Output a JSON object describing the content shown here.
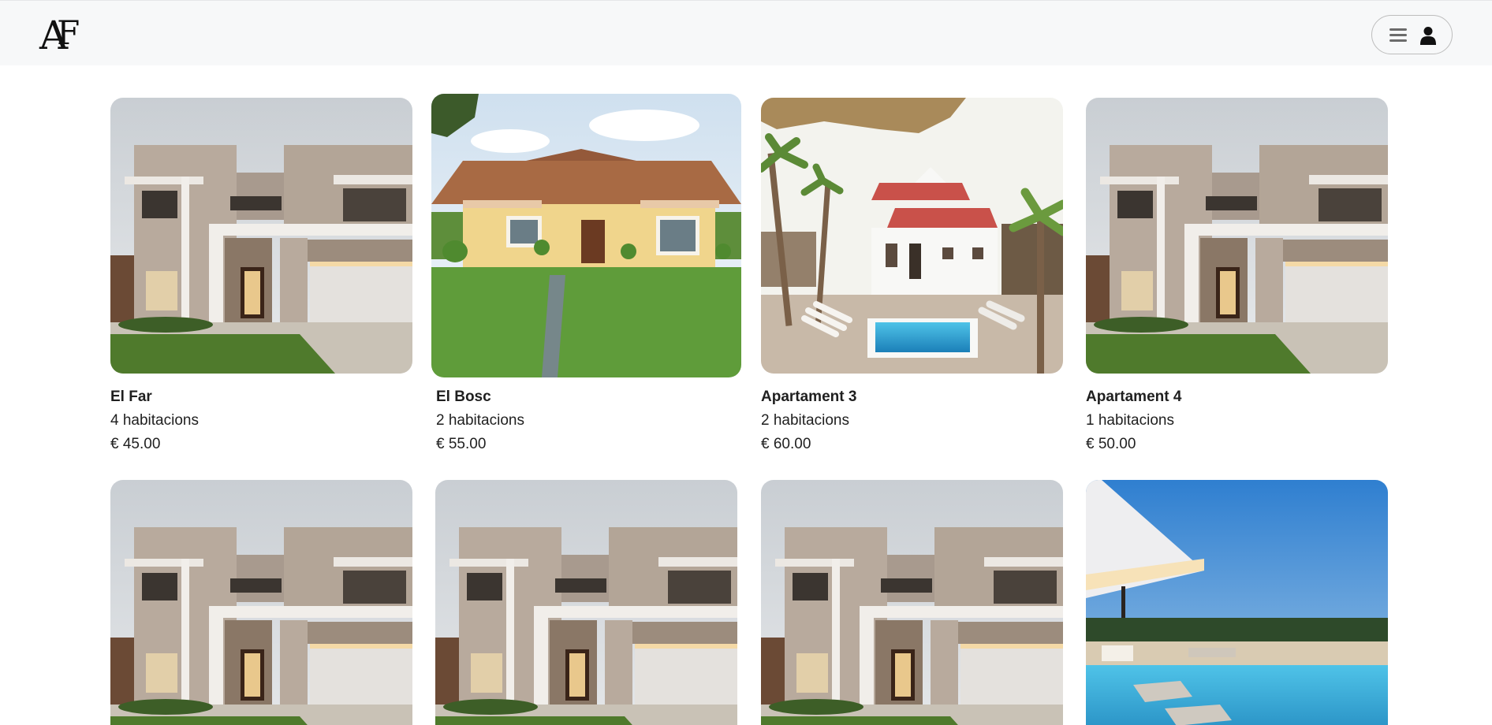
{
  "header": {
    "logo_text": "AF",
    "menu_icon": "hamburger-menu-icon",
    "user_icon": "user-icon"
  },
  "listings": [
    {
      "title": "El Far",
      "rooms": "4 habitacions",
      "price": "€ 45.00",
      "image": "modern-house"
    },
    {
      "title": "El Bosc",
      "rooms": "2 habitacions",
      "price": "€ 55.00",
      "image": "villa-garden"
    },
    {
      "title": "Apartament 3",
      "rooms": "2 habitacions",
      "price": "€ 60.00",
      "image": "house-pool-palms"
    },
    {
      "title": "Apartament 4",
      "rooms": "1 habitacions",
      "price": "€ 50.00",
      "image": "modern-house"
    },
    {
      "title": "",
      "rooms": "",
      "price": "",
      "image": "modern-house"
    },
    {
      "title": "",
      "rooms": "",
      "price": "",
      "image": "modern-house"
    },
    {
      "title": "",
      "rooms": "",
      "price": "",
      "image": "modern-house"
    },
    {
      "title": "",
      "rooms": "",
      "price": "",
      "image": "luxury-pool-dusk"
    }
  ],
  "colors": {
    "header_bg": "#f7f8f9",
    "text": "#1f1f1f"
  }
}
